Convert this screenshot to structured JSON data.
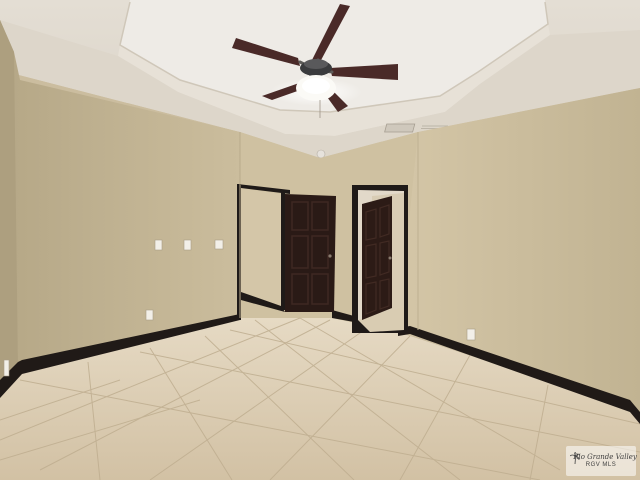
{
  "photo": {
    "subject": "empty-bedroom-interior",
    "colors": {
      "wall": "#d3c5a6",
      "wall_shadow": "#bfb191",
      "ceiling": "#eeeae3",
      "trim": "#1f1a18",
      "door": "#2a1a16",
      "floor": "#d9c9ad",
      "grout": "#c2b293"
    }
  },
  "watermark": {
    "brand": "Rio Grande Valley",
    "sub": "RGV MLS"
  }
}
